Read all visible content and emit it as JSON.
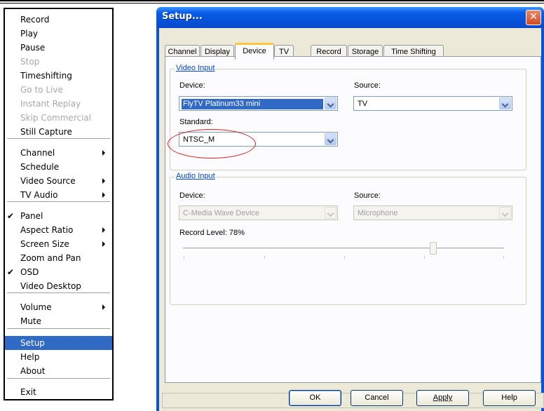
{
  "menu": {
    "items": [
      {
        "label": "Record",
        "disabled": false
      },
      {
        "label": "Play",
        "disabled": false
      },
      {
        "label": "Pause",
        "disabled": false
      },
      {
        "label": "Stop",
        "disabled": true
      },
      {
        "label": "Timeshifting",
        "disabled": false
      },
      {
        "label": "Go to Live",
        "disabled": true
      },
      {
        "label": "Instant Replay",
        "disabled": true
      },
      {
        "label": "Skip Commercial",
        "disabled": true
      },
      {
        "label": "Still Capture",
        "disabled": false
      },
      {
        "label": "Channel",
        "submenu": true
      },
      {
        "label": "Schedule"
      },
      {
        "label": "Video Source",
        "submenu": true
      },
      {
        "label": "TV Audio",
        "submenu": true
      },
      {
        "label": "Panel",
        "checked": true
      },
      {
        "label": "Aspect Ratio",
        "submenu": true
      },
      {
        "label": "Screen Size",
        "submenu": true
      },
      {
        "label": "Zoom and Pan"
      },
      {
        "label": "OSD",
        "checked": true
      },
      {
        "label": "Video Desktop"
      },
      {
        "label": "Volume",
        "submenu": true
      },
      {
        "label": "Mute"
      },
      {
        "label": "Setup",
        "selected": true
      },
      {
        "label": "Help"
      },
      {
        "label": "About"
      },
      {
        "label": "Exit"
      }
    ],
    "check_glyph": "✔"
  },
  "window": {
    "title": "Setup...",
    "close_glyph": "✕",
    "tabs": [
      "Channel",
      "Display",
      "Device",
      "TV",
      "Record",
      "Storage",
      "Time Shifting"
    ],
    "active_tab": "Device"
  },
  "video_input": {
    "group_label": "Video Input",
    "device_label": "Device:",
    "device_value": "FlyTV Platinum33 mini",
    "source_label": "Source:",
    "source_value": "TV",
    "standard_label": "Standard:",
    "standard_value": "NTSC_M"
  },
  "audio_input": {
    "group_label": "Audio Input",
    "device_label": "Device:",
    "device_value": "C-Media Wave Device",
    "source_label": "Source:",
    "source_value": "Microphone",
    "record_level_label": "Record Level: 78%",
    "record_level": 0.78
  },
  "buttons": {
    "ok": "OK",
    "cancel": "Cancel",
    "apply": "Apply",
    "help": "Help"
  },
  "colors": {
    "menu_highlight": "#316ac5",
    "titlebar": "#0450d8",
    "annotation": "#d02020"
  }
}
